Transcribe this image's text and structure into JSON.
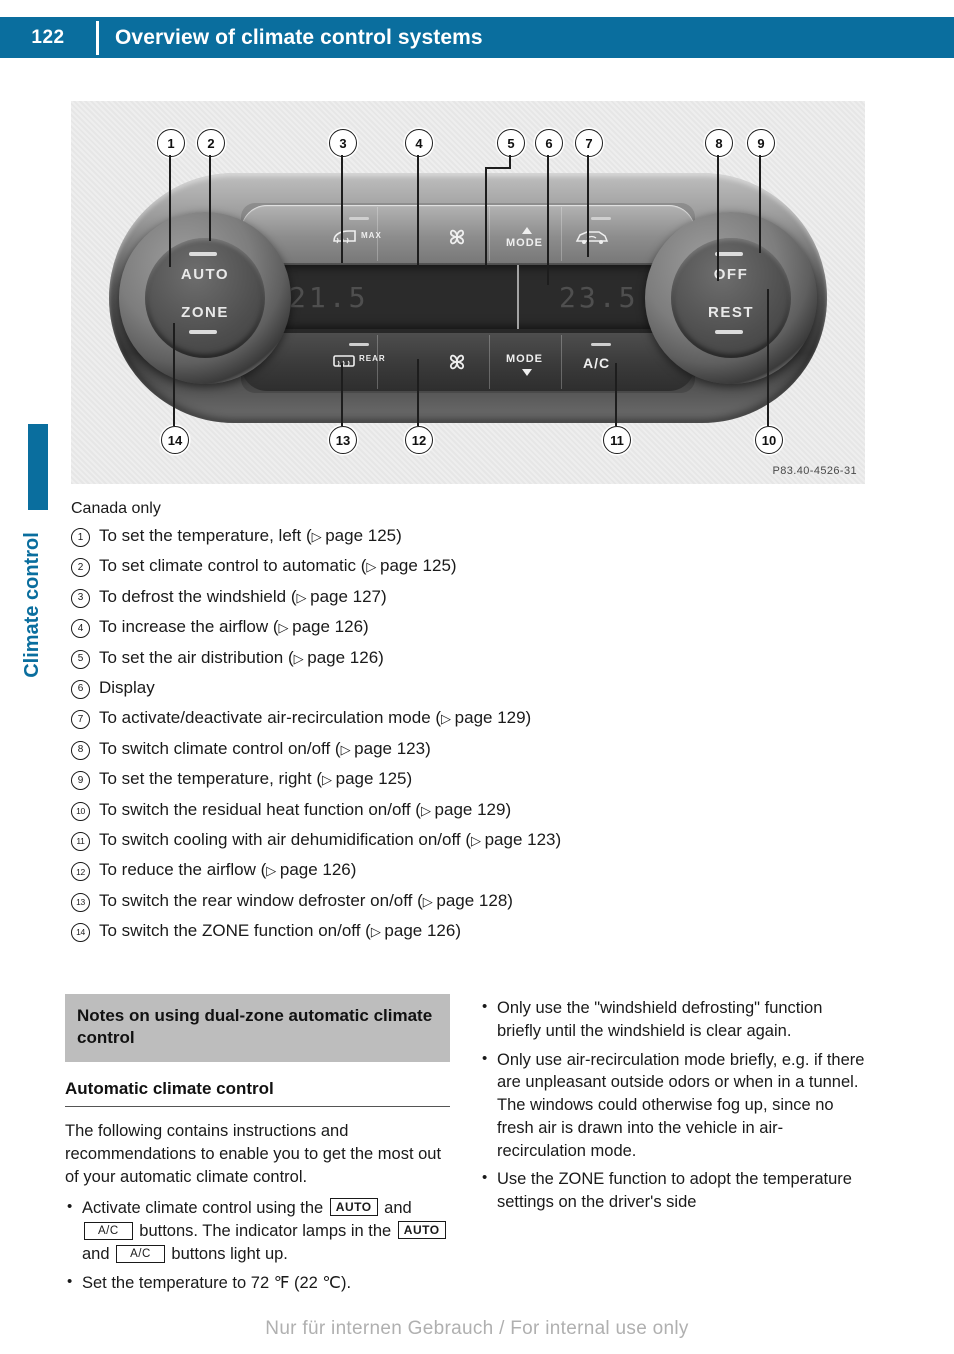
{
  "header": {
    "page_number": "122",
    "title": "Overview of climate control systems",
    "accent_color": "#0a6e9e"
  },
  "side_tab": {
    "label": "Climate control"
  },
  "figure": {
    "photo_id": "P83.40-4526-31",
    "panel": {
      "knob_left_top": "AUTO",
      "knob_left_bottom": "ZONE",
      "knob_right_top": "OFF",
      "knob_right_bottom": "REST",
      "btn_defrost": "MAX",
      "btn_fan_up": "fan-icon",
      "btn_mode_up": "MODE",
      "btn_recirc": "recirculation-icon",
      "btn_rear_defrost": "REAR",
      "btn_fan_down": "fan-icon",
      "btn_mode_down": "MODE",
      "btn_ac": "A/C",
      "display_left": "21.5",
      "display_right": "23.5"
    },
    "callouts": [
      "1",
      "2",
      "3",
      "4",
      "5",
      "6",
      "7",
      "8",
      "9",
      "10",
      "11",
      "12",
      "13",
      "14"
    ]
  },
  "legend": {
    "note": "Canada only",
    "items": [
      {
        "num": "1",
        "text": "To set the temperature, left (",
        "page": "page 125",
        "tail": ")"
      },
      {
        "num": "2",
        "text": "To set climate control to automatic (",
        "page": "page 125",
        "tail": ")"
      },
      {
        "num": "3",
        "text": "To defrost the windshield (",
        "page": "page 127",
        "tail": ")"
      },
      {
        "num": "4",
        "text": "To increase the airflow (",
        "page": "page 126",
        "tail": ")"
      },
      {
        "num": "5",
        "text": "To set the air distribution (",
        "page": "page 126",
        "tail": ")"
      },
      {
        "num": "6",
        "text": "Display",
        "page": "",
        "tail": ""
      },
      {
        "num": "7",
        "text": "To activate/deactivate air-recirculation mode (",
        "page": "page 129",
        "tail": ")"
      },
      {
        "num": "8",
        "text": "To switch climate control on/off (",
        "page": "page 123",
        "tail": ")"
      },
      {
        "num": "9",
        "text": "To set the temperature, right (",
        "page": "page 125",
        "tail": ")"
      },
      {
        "num": "10",
        "text": "To switch the residual heat function on/off (",
        "page": "page 129",
        "tail": ")"
      },
      {
        "num": "11",
        "text": "To switch cooling with air dehumidification on/off (",
        "page": "page 123",
        "tail": ")"
      },
      {
        "num": "12",
        "text": "To reduce the airflow (",
        "page": "page 126",
        "tail": ")"
      },
      {
        "num": "13",
        "text": "To switch the rear window defroster on/off (",
        "page": "page 128",
        "tail": ")"
      },
      {
        "num": "14",
        "text": "To switch the ZONE function on/off (",
        "page": "page 126",
        "tail": ")"
      }
    ]
  },
  "notes": {
    "box_heading": "Notes on using dual-zone automatic climate control",
    "sub_heading": "Automatic climate control",
    "paragraph": "The following contains instructions and recommendations to enable you to get the most out of your automatic climate control.",
    "bullet_activate_1": "Activate climate control using the",
    "bullet_activate_2": "and",
    "bullet_activate_3": "buttons. The indicator lamps in the",
    "bullet_activate_4": "and",
    "bullet_activate_5": "buttons light up.",
    "btn_auto": "AUTO",
    "btn_ac": "A/C",
    "bullet_temp": "Set the temperature to 72 ℉ (22 ℃).",
    "right_bullets": [
      "Only use the \"windshield defrosting\" function briefly until the windshield is clear again.",
      "Only use air-recirculation mode briefly, e.g. if there are unpleasant outside odors or when in a tunnel. The windows could otherwise fog up, since no fresh air is drawn into the vehicle in air-recirculation mode.",
      "Use the ZONE function to adopt the temperature settings on the driver's side"
    ]
  },
  "footer": {
    "text": "Nur für internen Gebrauch / For internal use only"
  }
}
